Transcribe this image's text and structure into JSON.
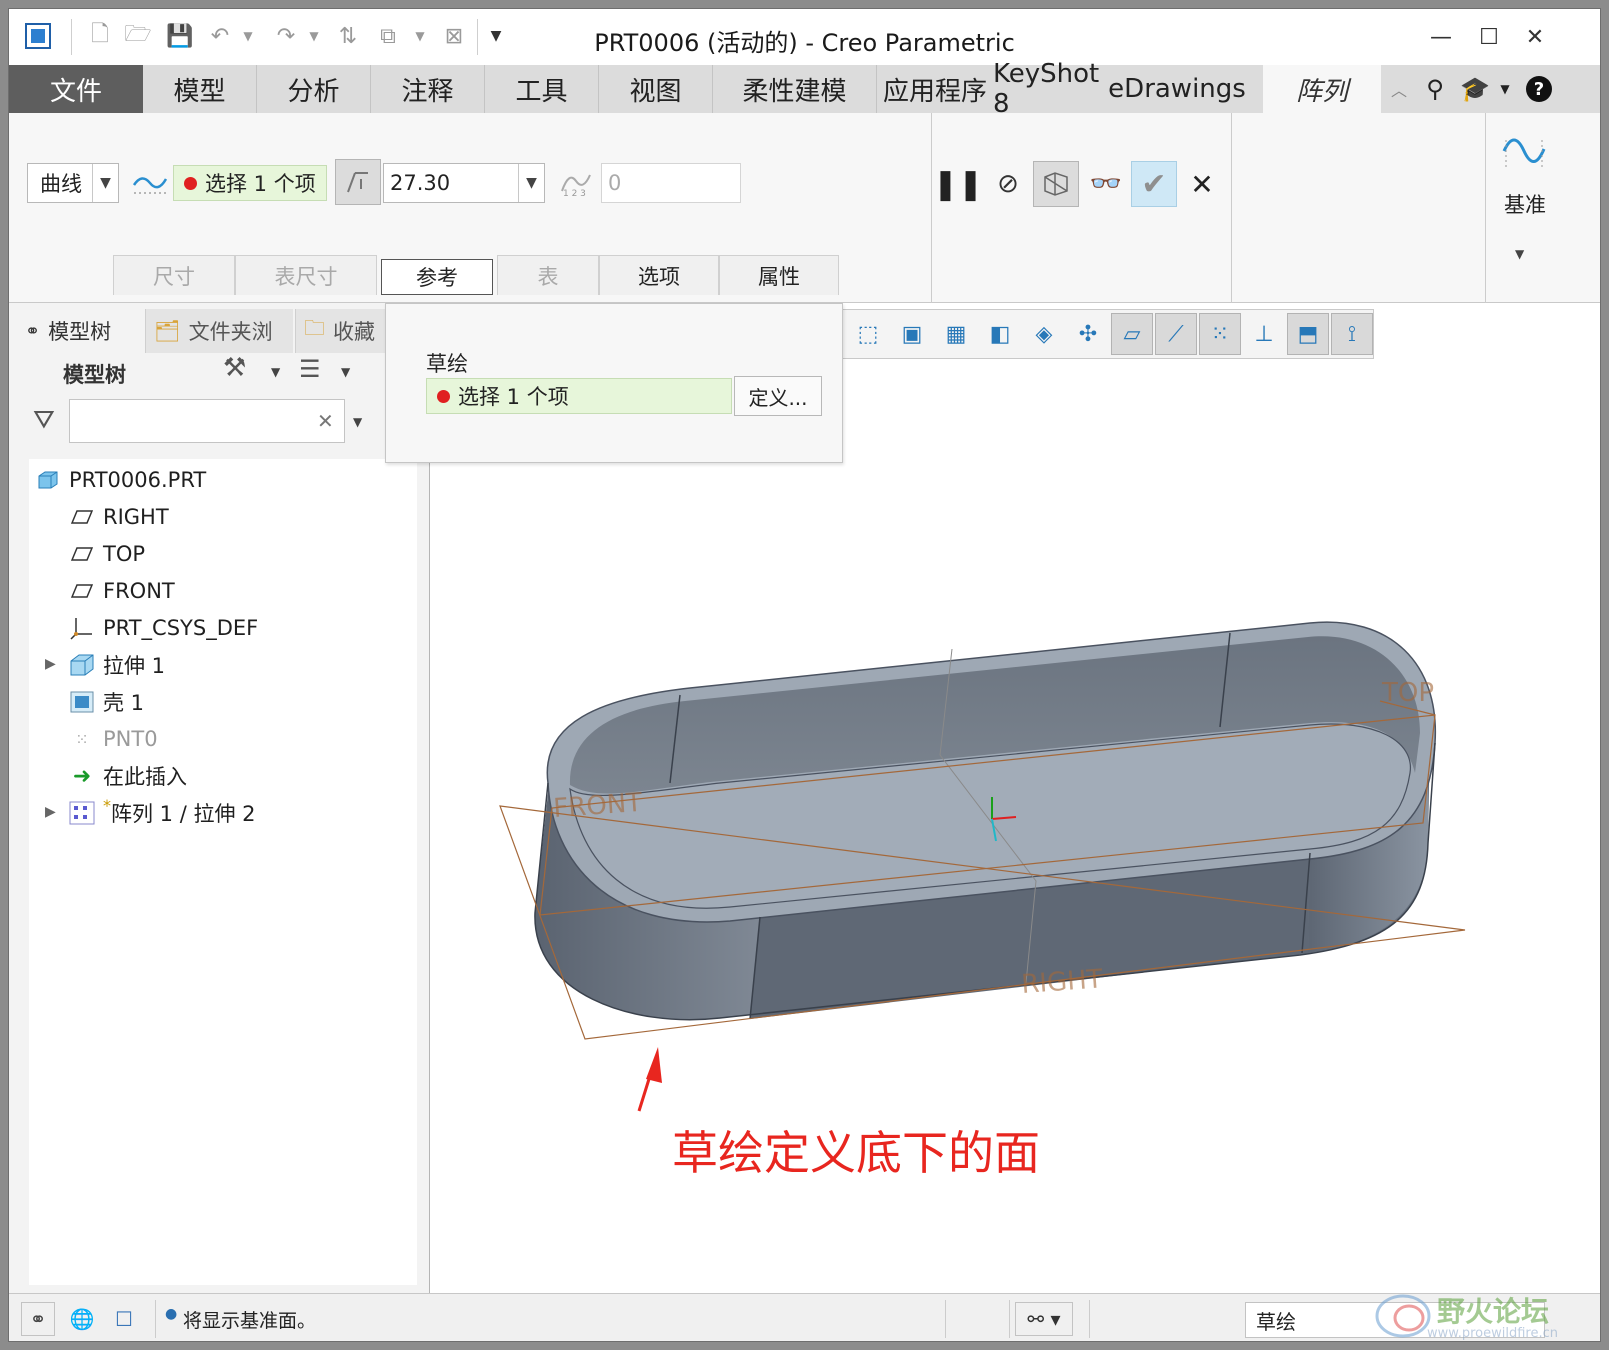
{
  "titlebar": {
    "title": "PRT0006 (活动的) - Creo Parametric"
  },
  "ribbon_tabs": [
    {
      "label": "文件"
    },
    {
      "label": "模型"
    },
    {
      "label": "分析"
    },
    {
      "label": "注释"
    },
    {
      "label": "工具"
    },
    {
      "label": "视图"
    },
    {
      "label": "柔性建模"
    },
    {
      "label": "应用程序"
    },
    {
      "label": "KeyShot 8"
    },
    {
      "label": "eDrawings"
    },
    {
      "label": "阵列"
    }
  ],
  "ribbon": {
    "pattern_type": "曲线",
    "curve_select": "选择 1 个项",
    "spacing_value": "27.30",
    "member_count": "0",
    "datum_label": "基准"
  },
  "subtabs": [
    {
      "label": "尺寸"
    },
    {
      "label": "表尺寸"
    },
    {
      "label": "参考"
    },
    {
      "label": "表"
    },
    {
      "label": "选项"
    },
    {
      "label": "属性"
    }
  ],
  "ref_popup": {
    "sketch_label": "草绘",
    "sketch_select": "选择 1 个项",
    "define_button": "定义..."
  },
  "left_panel": {
    "tabs": [
      {
        "label": "模型树"
      },
      {
        "label": "文件夹浏"
      },
      {
        "label": "收藏"
      }
    ],
    "header": "模型树",
    "filter_value": ""
  },
  "model_tree": [
    {
      "label": "PRT0006.PRT",
      "icon": "part-icon"
    },
    {
      "label": "RIGHT",
      "icon": "datum-plane-icon"
    },
    {
      "label": "TOP",
      "icon": "datum-plane-icon"
    },
    {
      "label": "FRONT",
      "icon": "datum-plane-icon"
    },
    {
      "label": "PRT_CSYS_DEF",
      "icon": "csys-icon"
    },
    {
      "label": "拉伸 1",
      "icon": "extrude-icon"
    },
    {
      "label": "壳 1",
      "icon": "shell-icon"
    },
    {
      "label": "PNT0",
      "icon": "datum-point-icon"
    },
    {
      "label": "在此插入",
      "icon": "insert-here-icon"
    },
    {
      "label": "阵列 1 / 拉伸 2",
      "icon": "pattern-icon",
      "prefix": "*"
    }
  ],
  "viewport": {
    "plane_labels": {
      "front": "FRONT",
      "top": "TOP",
      "right": "RIGHT"
    },
    "annotation": "草绘定义底下的面"
  },
  "statusbar": {
    "message": "将显示基准面。",
    "filter_value": "草绘"
  },
  "watermark": {
    "name": "野火论坛",
    "url": "www.proewildfire.cn"
  },
  "colors": {
    "file_tab": "#5e5e5e",
    "selection_green": "#e7f6da",
    "annotation_red": "#e8261f",
    "datum_plane": "#a4683a",
    "model_dark": "#66707e",
    "model_light": "#a2acb8"
  }
}
